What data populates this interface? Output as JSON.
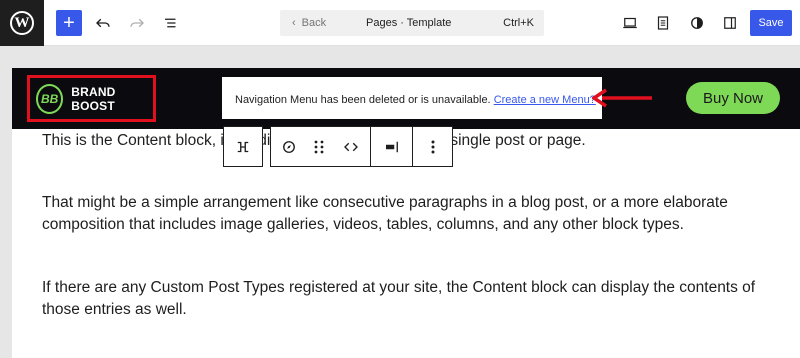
{
  "toolbar": {
    "wp_logo": "W",
    "add_icon": "+",
    "command": {
      "back_arrow": "‹",
      "back_label": "Back",
      "title": "Pages · Template",
      "shortcut": "Ctrl+K"
    },
    "save_label": "Save"
  },
  "header": {
    "logo_mark": "BB",
    "logo_text": "BRAND BOOST",
    "buy_label": "Buy Now",
    "accent_color": "#7ed957",
    "highlight_color": "#e0101e"
  },
  "notice": {
    "message": "Navigation Menu has been deleted or is unavailable.",
    "link": "Create a new Menu?"
  },
  "content": {
    "paragraphs": [
      "This is the Content block, it will display all the blocks in any single post or page.",
      "That might be a simple arrangement like consecutive paragraphs in a blog post, or a more elaborate composition that includes image galleries, videos, tables, columns, and any other block types.",
      "If there are any Custom Post Types registered at your site, the Content block can display the contents of those entries as well."
    ]
  }
}
